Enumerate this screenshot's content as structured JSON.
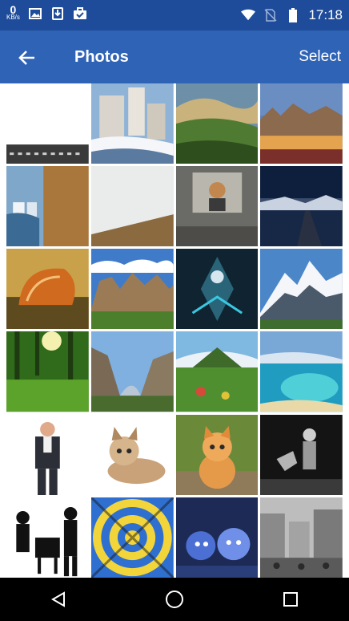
{
  "status_bar": {
    "net_speed_value": "0",
    "net_speed_unit": "KB/s",
    "time": "17:18",
    "icons": [
      "image-icon",
      "download-icon",
      "briefcase-icon",
      "wifi-icon",
      "no-sim-icon",
      "battery-icon"
    ]
  },
  "app_bar": {
    "title": "Photos",
    "select_label": "Select",
    "back_icon": "arrow-back-icon"
  },
  "photos": [
    {
      "subject": "screen with text lines"
    },
    {
      "subject": "snowy castle"
    },
    {
      "subject": "green hills landscape"
    },
    {
      "subject": "city at dusk"
    },
    {
      "subject": "phone screen photo"
    },
    {
      "subject": "whiteboard"
    },
    {
      "subject": "projector presentation"
    },
    {
      "subject": "pier at night"
    },
    {
      "subject": "seashell"
    },
    {
      "subject": "rock cliffs"
    },
    {
      "subject": "fantasy warrior"
    },
    {
      "subject": "snowy mountain"
    },
    {
      "subject": "sunlit forest"
    },
    {
      "subject": "valley"
    },
    {
      "subject": "tropical island"
    },
    {
      "subject": "lagoon"
    },
    {
      "subject": "businessman"
    },
    {
      "subject": "kitten lying"
    },
    {
      "subject": "kitten sitting"
    },
    {
      "subject": "jazz musicians"
    },
    {
      "subject": "jazz silhouettes"
    },
    {
      "subject": "optical illusion"
    },
    {
      "subject": "cartoon kittens"
    },
    {
      "subject": "old street photo"
    }
  ],
  "nav_bar": {
    "icons": [
      "back-triangle-icon",
      "home-circle-icon",
      "recents-square-icon"
    ]
  }
}
